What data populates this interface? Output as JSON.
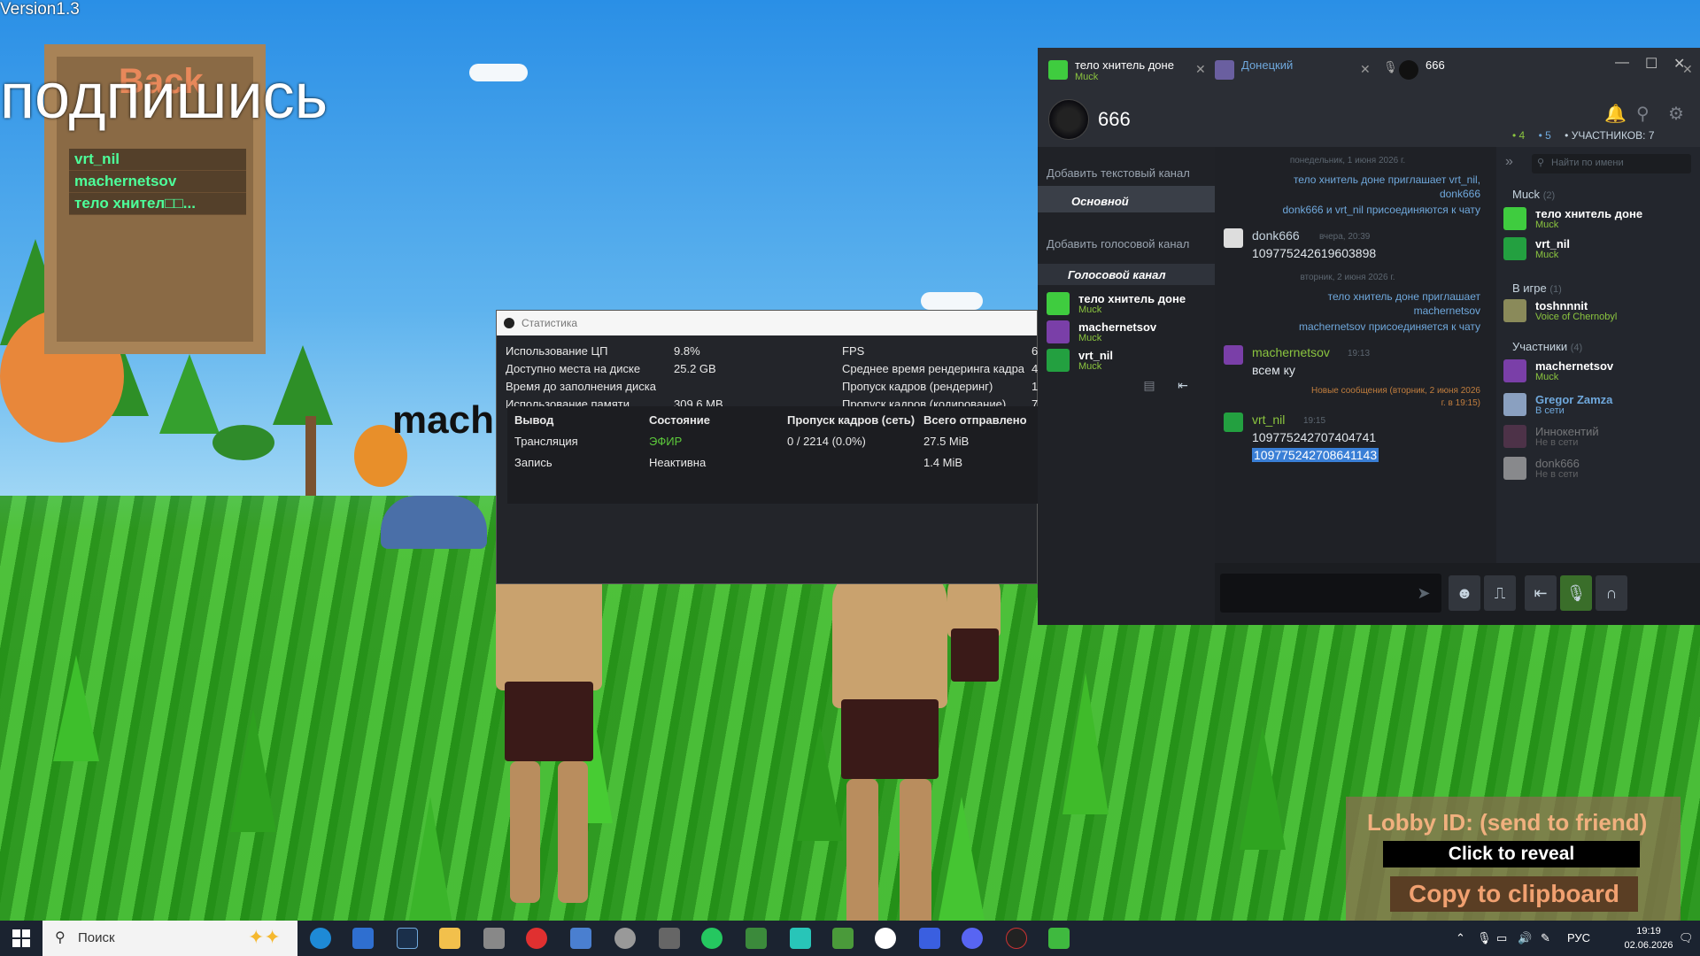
{
  "game": {
    "version": "Version1.3",
    "board_back": "Back",
    "subscribe_text": "подпишись",
    "board_players": [
      "vrt_nil",
      "machernetsov",
      "тело хнител□□..."
    ],
    "floating_name": "mach"
  },
  "stats": {
    "title": "Статистика",
    "left_labels": [
      "Использование ЦП",
      "Доступно места на диске",
      "Время до заполнения диска",
      "Использование памяти"
    ],
    "left_values": [
      "9.8%",
      "25.2 GB",
      "",
      "309.6 MB"
    ],
    "right_labels": [
      "FPS",
      "Среднее время рендеринга кадра",
      "Пропуск кадров (рендеринг)",
      "Пропуск кадров (кодирование)"
    ],
    "right_values": [
      "6",
      "4",
      "1",
      "7"
    ],
    "output_headers": [
      "Вывод",
      "Состояние",
      "Пропуск кадров (сеть)",
      "Всего отправлено"
    ],
    "output_rows": [
      [
        "Трансляция",
        "ЭФИР",
        "0 / 2214 (0.0%)",
        "27.5 MiB"
      ],
      [
        "Запись",
        "Неактивна",
        "",
        "1.4 MiB"
      ]
    ],
    "live_color": "#5cc93b"
  },
  "chat": {
    "tabs": [
      {
        "name": "тело хнитель доне",
        "sub": "Muck"
      },
      {
        "name": "Донецкий",
        "sub": ""
      },
      {
        "name": "666",
        "sub": ""
      }
    ],
    "group_name": "666",
    "counts": {
      "in_game": "4",
      "online": "5",
      "members": "УЧАСТНИКОВ: 7"
    },
    "channels": {
      "add_text": "Добавить текстовый канал",
      "main": "Основной",
      "add_voice": "Добавить голосовой канал",
      "voice": "Голосовой канал",
      "voice_members": [
        {
          "name": "тело хнитель доне",
          "game": "Muck"
        },
        {
          "name": "machernetsov",
          "game": "Muck"
        },
        {
          "name": "vrt_nil",
          "game": "Muck"
        }
      ]
    },
    "messages": {
      "date1": "понедельник, 1 июня 2026 г.",
      "sys1": "тело хнитель доне приглашает vrt_nil,",
      "sys1b": "donk666",
      "sys2": "donk666 и vrt_nil присоединяются к чату",
      "donk_name": "donk666",
      "donk_time": "вчера, 20:39",
      "donk_text": "109775242619603898",
      "date2": "вторник, 2 июня 2026 г.",
      "sys3": "тело хнитель доне приглашает",
      "sys3b": "machernetsov",
      "sys4": "machernetsov присоединяется к чату",
      "mach_name": "machernetsov",
      "mach_time": "19:13",
      "mach_text": "всем ку",
      "new_msgs": "Новые сообщения (вторник, 2 июня 2026",
      "new_msgs_b": "г. в 19:15)",
      "vrt_name": "vrt_nil",
      "vrt_time": "19:15",
      "vrt_text1": "109775242707404741",
      "vrt_text2": "109775242708641143"
    },
    "members": {
      "search_placeholder": "Найти по имени",
      "group_muck": "Muck",
      "group_muck_count": "(2)",
      "muck_members": [
        {
          "name": "тело хнитель доне",
          "status": "Muck"
        },
        {
          "name": "vrt_nil",
          "status": "Muck"
        }
      ],
      "group_ingame": "В игре",
      "group_ingame_count": "(1)",
      "ingame_members": [
        {
          "name": "toshnnnit",
          "status": "Voice of Chernobyl"
        }
      ],
      "group_participants": "Участники",
      "group_participants_count": "(4)",
      "participants": [
        {
          "name": "machernetsov",
          "status": "Muck"
        },
        {
          "name": "Gregor Zamza",
          "status": "В сети"
        },
        {
          "name": "Иннокентий",
          "status": "Не в сети"
        },
        {
          "name": "donk666",
          "status": "Не в сети"
        }
      ]
    }
  },
  "lobby": {
    "title": "Lobby ID: (send to friend)",
    "reveal": "Click to reveal",
    "copy": "Copy to clipboard"
  },
  "taskbar": {
    "search_label": "Поиск",
    "lang": "РУС",
    "time": "19:19",
    "date": "02.06.2026"
  }
}
